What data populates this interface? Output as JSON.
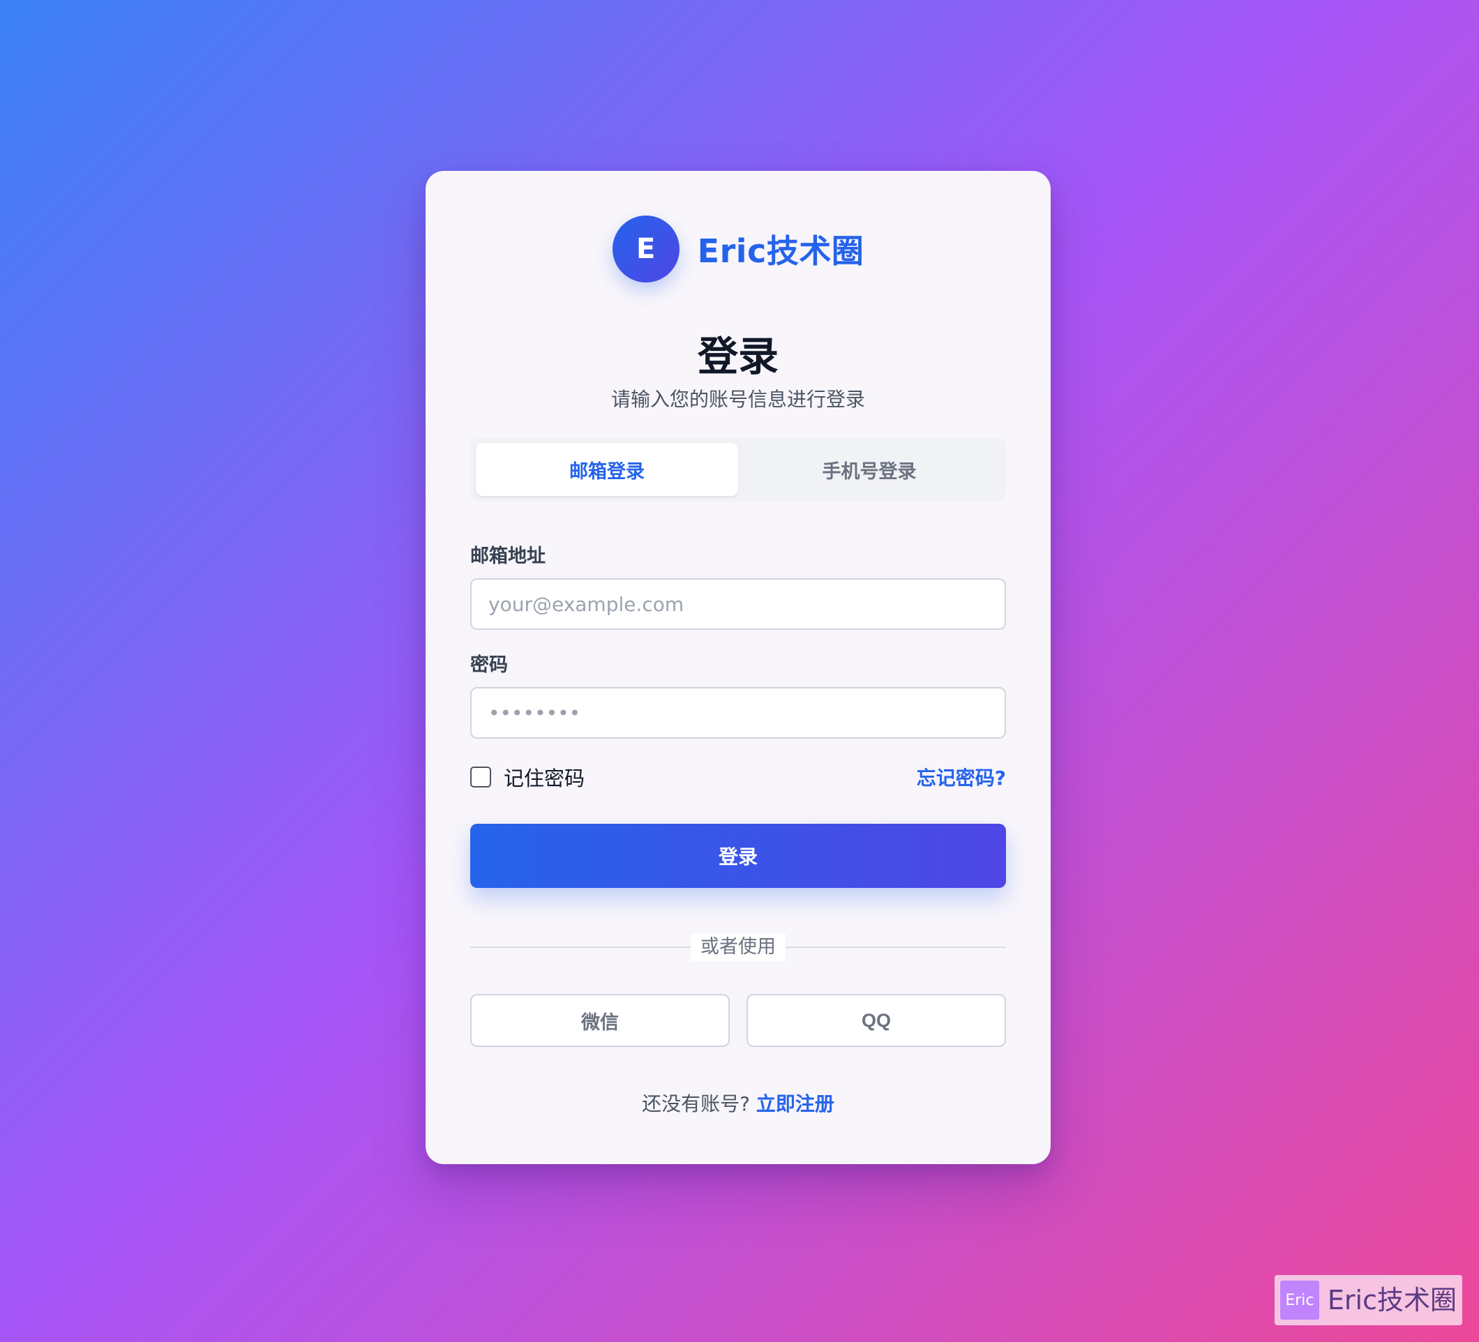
{
  "brand": {
    "logo_letter": "E",
    "name": "Eric技术圈"
  },
  "login": {
    "title": "登录",
    "subtitle": "请输入您的账号信息进行登录",
    "tabs": [
      {
        "label": "邮箱登录",
        "selected": true
      },
      {
        "label": "手机号登录",
        "selected": false
      }
    ],
    "email": {
      "label": "邮箱地址",
      "value": "",
      "placeholder": "your@example.com"
    },
    "password": {
      "label": "密码",
      "value": "",
      "placeholder": "••••••••"
    },
    "remember_label": "记住密码",
    "remember_checked": false,
    "forgot_label": "忘记密码?",
    "submit_label": "登录",
    "divider_label": "或者使用",
    "social_buttons": [
      {
        "label": "微信"
      },
      {
        "label": "QQ"
      }
    ],
    "footer_prompt": "还没有账号?",
    "register_link": "立即注册"
  },
  "watermark": {
    "icon_text": "Eric",
    "text": "Eric技术圈"
  },
  "colors": {
    "background_start": "#3b82f6",
    "background_mid": "#a855f7",
    "background_end": "#ec4899",
    "accent": "#2563eb",
    "accent_secondary": "#4f46e5"
  }
}
